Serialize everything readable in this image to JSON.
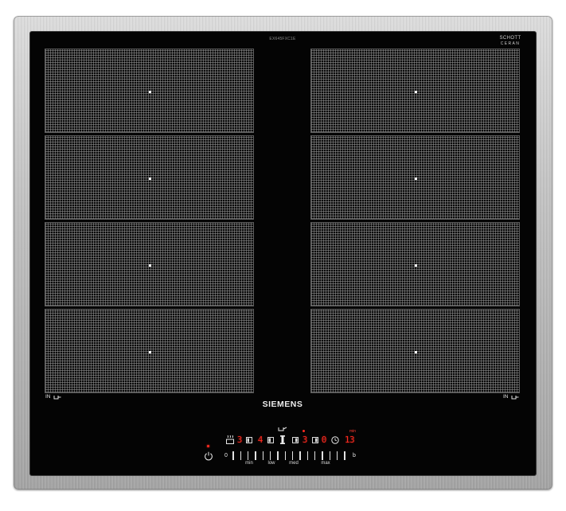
{
  "cooktop": {
    "model_code": "EX645FXC1E",
    "brand": "SIEMENS",
    "glass_logo_top": "SCHOTT",
    "glass_logo_bottom": "CERAN",
    "left_zone_label": "IN",
    "right_zone_label": "IN"
  },
  "control_panel": {
    "zone_displays": [
      {
        "value": "3"
      },
      {
        "value": "4"
      },
      {
        "value": "3",
        "selected": true
      },
      {
        "value": "0"
      }
    ],
    "timer_display": "13",
    "timer_unit": "min",
    "slider_zero": "0",
    "slider_labels": [
      "min",
      "low",
      "med",
      "max"
    ],
    "boost_label": "b"
  },
  "icons": {
    "power": "power-icon",
    "frying_sensor": "frying-sensor-icon",
    "flex_mode": "flex-mode-icon",
    "zone_select": "zone-select-icon",
    "move_function": "move-function-icon",
    "timer": "clock-icon",
    "induction_zone": "induction-pan-icon"
  },
  "colors": {
    "display_red": "#ff2b20",
    "glass": "#040404",
    "steel_frame": "#c4c4c4",
    "zone_grid": "#969696"
  }
}
